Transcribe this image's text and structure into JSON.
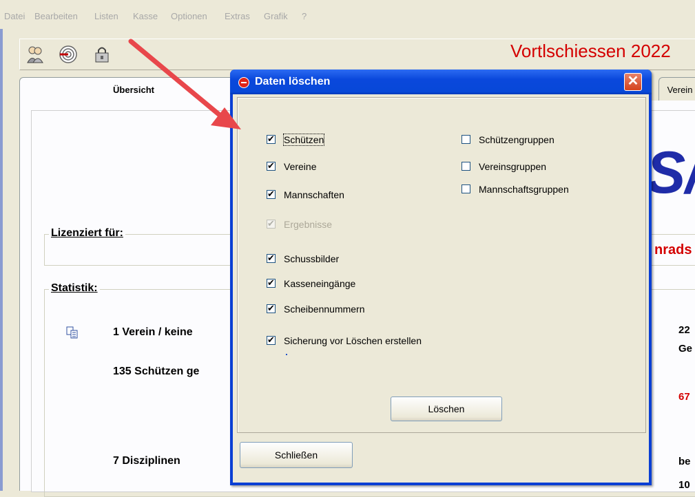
{
  "menu": [
    "Datei",
    "Bearbeiten",
    "Listen",
    "Kasse",
    "Optionen",
    "Extras",
    "Grafik",
    "?"
  ],
  "toolbar": {
    "icons": [
      "people-icon",
      "target-icon",
      "lock-icon"
    ],
    "app_title": "Vortlschiessen 2022"
  },
  "tabs": {
    "overview": "Übersicht",
    "verein": "Verein"
  },
  "main": {
    "licensed_label": "Lizenziert für:",
    "stats_label": "Statistik:",
    "stat_vereine": "1 Verein  / keine",
    "stat_schuetzen": "135 Schützen ge",
    "stat_disziplinen": "7 Disziplinen",
    "right_22": "22",
    "right_ge": "Ge",
    "right_67": "67",
    "right_be": "be",
    "right_10": "10",
    "logo_partial": "S/",
    "red_partial": "nrads"
  },
  "dialog": {
    "title": "Daten löschen",
    "close": "✕",
    "left_options": [
      {
        "label": "Schützen",
        "checked": true,
        "enabled": true
      },
      {
        "label": "Vereine",
        "checked": true,
        "enabled": true
      },
      {
        "label": "Mannschaften",
        "checked": true,
        "enabled": true
      },
      {
        "label": "Ergebnisse",
        "checked": true,
        "enabled": false
      },
      {
        "label": "Schussbilder",
        "checked": true,
        "enabled": true
      },
      {
        "label": "Kasseneingänge",
        "checked": true,
        "enabled": true
      },
      {
        "label": "Scheibennummern",
        "checked": true,
        "enabled": true
      },
      {
        "label": "Sicherung vor Löschen erstellen",
        "checked": true,
        "enabled": true
      }
    ],
    "right_options": [
      {
        "label": "Schützengruppen",
        "checked": false,
        "enabled": true
      },
      {
        "label": "Vereinsgruppen",
        "checked": false,
        "enabled": true
      },
      {
        "label": "Mannschaftsgruppen",
        "checked": false,
        "enabled": true
      }
    ],
    "delete_button": "Löschen",
    "close_button": "Schließen"
  },
  "colors": {
    "title_red": "#d40000",
    "xp_blue": "#0a48dc",
    "arrow": "#e8474b"
  }
}
